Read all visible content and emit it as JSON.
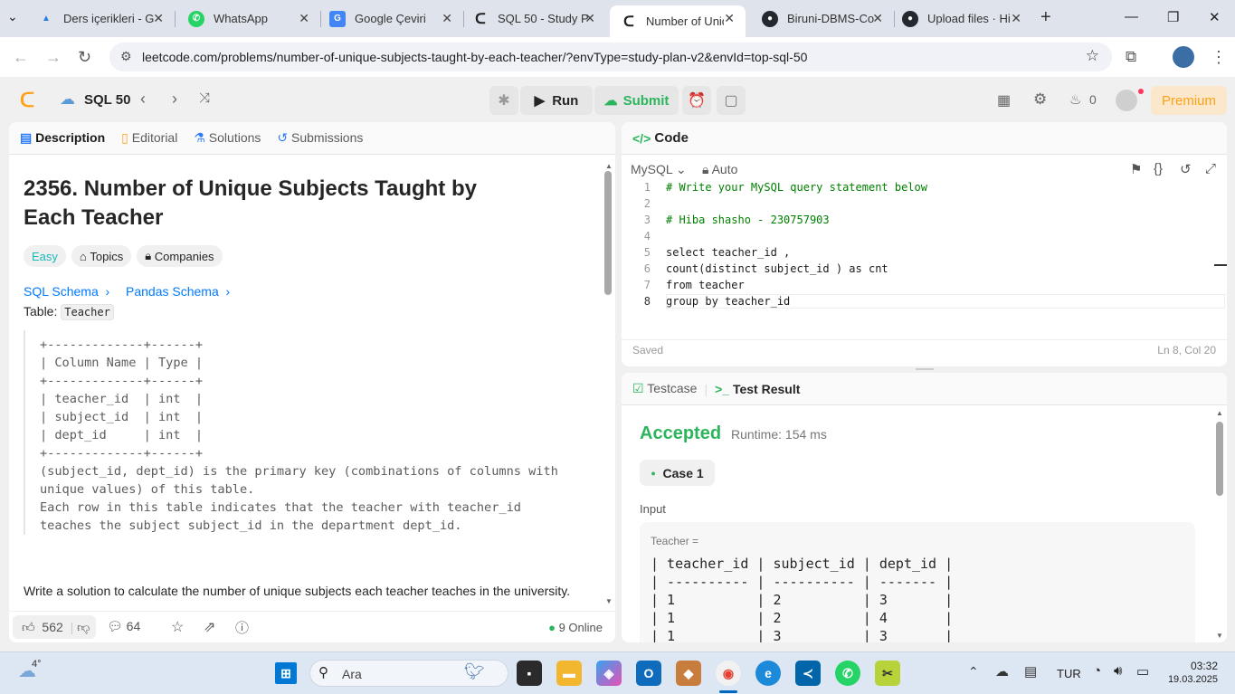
{
  "tabs": [
    {
      "title": "Ders içerikleri - G",
      "fav": "▲",
      "color": "#2a7de1"
    },
    {
      "title": "WhatsApp",
      "fav": "✆",
      "color": "#25d366"
    },
    {
      "title": "Google Çeviri",
      "fav": "G",
      "color": "#4285f4"
    },
    {
      "title": "SQL 50 - Study P",
      "fav": "⟨",
      "color": "#e5a13b"
    },
    {
      "title": "Number of Uniq",
      "fav": "⟨",
      "color": "#e5a13b"
    },
    {
      "title": "Biruni-DBMS-Co",
      "fav": "●",
      "color": "#24292f"
    },
    {
      "title": "Upload files · Hi",
      "fav": "●",
      "color": "#24292f"
    }
  ],
  "url": "leetcode.com/problems/number-of-unique-subjects-taught-by-each-teacher/?envType=study-plan-v2&envId=top-sql-50",
  "app": {
    "plan": "SQL 50",
    "run": "Run",
    "submit": "Submit",
    "streak": "0",
    "premium": "Premium"
  },
  "left": {
    "tabs": [
      "Description",
      "Editorial",
      "Solutions",
      "Submissions"
    ],
    "title": "2356. Number of Unique Subjects Taught by Each Teacher",
    "difficulty": "Easy",
    "topics": "Topics",
    "companies": "Companies",
    "schema1": "SQL Schema",
    "schema2": "Pandas Schema",
    "table_label": "Table:",
    "table_name": "Teacher",
    "schema_block": "+-------------+------+\n| Column Name | Type |\n+-------------+------+\n| teacher_id  | int  |\n| subject_id  | int  |\n| dept_id     | int  |\n+-------------+------+\n(subject_id, dept_id) is the primary key (combinations of columns with\nunique values) of this table.\nEach row in this table indicates that the teacher with teacher_id\nteaches the subject subject_id in the department dept_id.",
    "statement": "Write a solution to calculate the number of unique subjects each teacher teaches in the university.",
    "likes": "562",
    "comments": "64",
    "online": "9 Online"
  },
  "code": {
    "header": "Code",
    "lang": "MySQL",
    "auto": "Auto",
    "saved": "Saved",
    "pos": "Ln 8, Col 20",
    "lines": [
      {
        "n": "1",
        "t": "# Write your MySQL query statement below"
      },
      {
        "n": "2",
        "t": ""
      },
      {
        "n": "3",
        "t": "# Hiba shasho - 230757903"
      },
      {
        "n": "4",
        "t": ""
      },
      {
        "n": "5",
        "t": "select teacher_id ,"
      },
      {
        "n": "6",
        "t": "count(distinct subject_id ) as cnt"
      },
      {
        "n": "7",
        "t": "from teacher"
      },
      {
        "n": "8",
        "t": "group by teacher_id"
      }
    ]
  },
  "result": {
    "tab1": "Testcase",
    "tab2": "Test Result",
    "status": "Accepted",
    "runtime": "Runtime: 154 ms",
    "case": "Case 1",
    "input": "Input",
    "var": "Teacher =",
    "table": "| teacher_id | subject_id | dept_id |\n| ---------- | ---------- | ------- |\n| 1          | 2          | 3       |\n| 1          | 2          | 4       |\n| 1          | 3          | 3       |"
  },
  "taskbar": {
    "temp": "4°",
    "search": "Ara",
    "lang": "TUR",
    "time": "03:32",
    "date": "19.03.2025"
  }
}
